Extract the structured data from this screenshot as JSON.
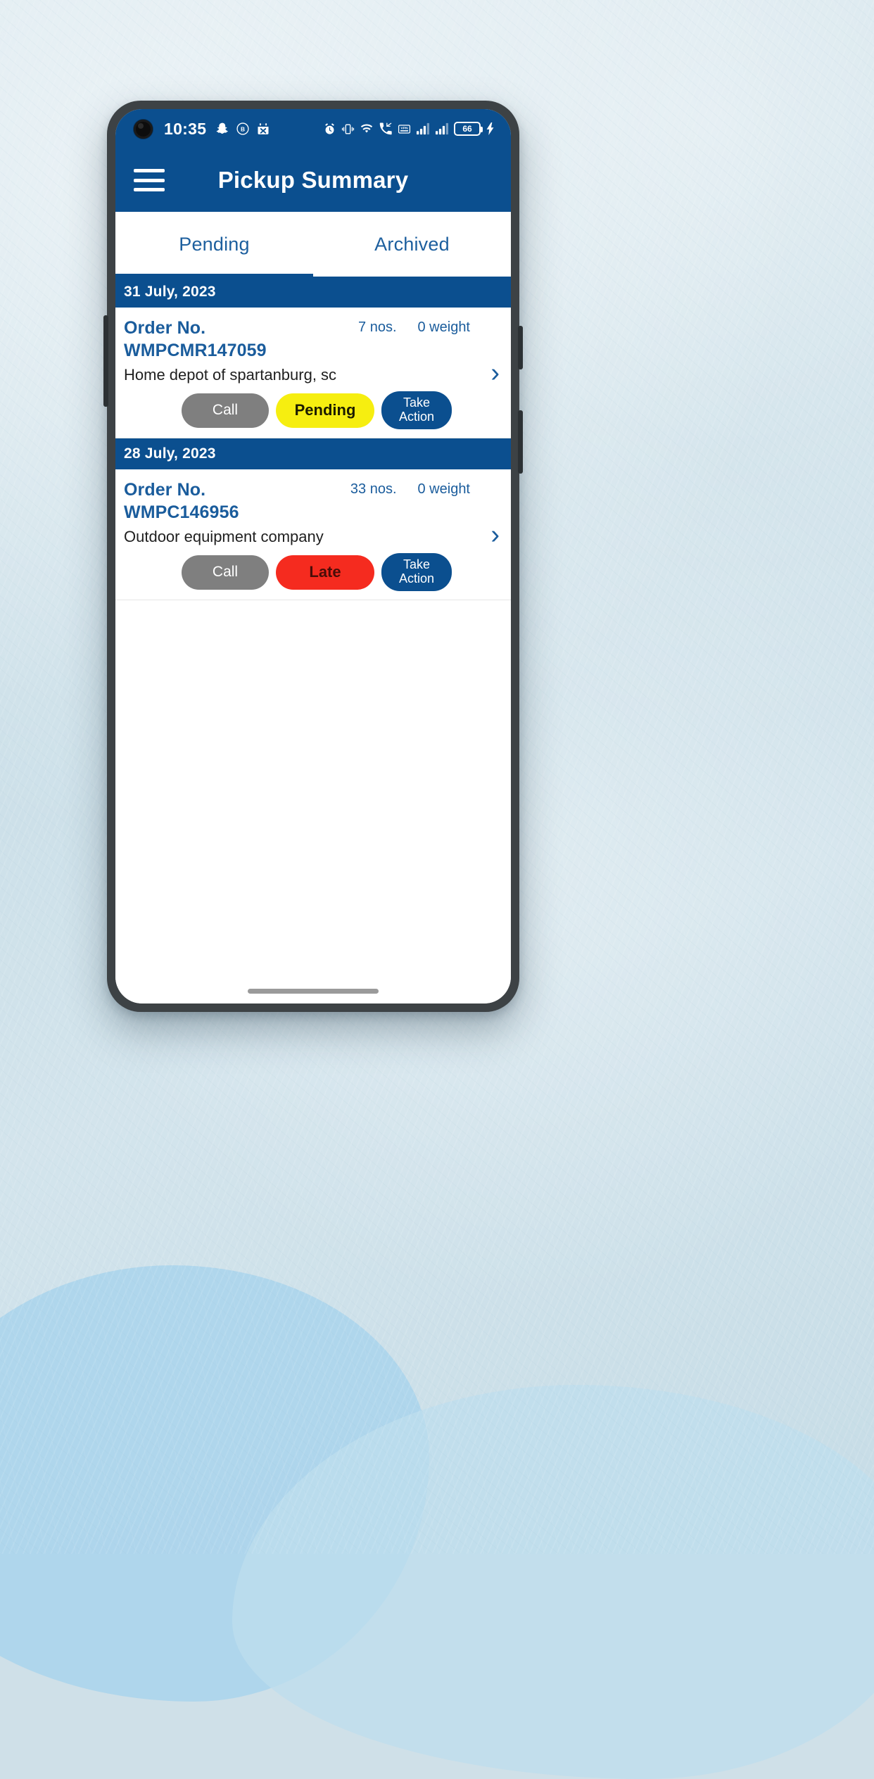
{
  "status_bar": {
    "time": "10:35",
    "battery_level": "66",
    "left_icons": [
      "snapchat-icon",
      "circled-b-icon",
      "calendar-event-icon"
    ],
    "right_icons": [
      "alarm-icon",
      "vibrate-icon",
      "wifi-icon",
      "missed-call-icon",
      "vpn-key-icon",
      "signal-bars-icon",
      "signal-bars-2-icon",
      "battery-icon",
      "charging-bolt-icon"
    ]
  },
  "app_bar": {
    "title": "Pickup Summary",
    "menu_icon": "hamburger-menu-icon"
  },
  "tabs": [
    {
      "label": "Pending",
      "active": true
    },
    {
      "label": "Archived",
      "active": false
    }
  ],
  "colors": {
    "primary": "#0b4f8f",
    "link": "#1a5c9c",
    "call_grey": "#7f7f7f",
    "pending_yellow": "#f6ee10",
    "late_red": "#f52b1f"
  },
  "groups": [
    {
      "date": "31 July, 2023",
      "orders": [
        {
          "order_label": "Order No.",
          "order_number": "WMPCMR147059",
          "count": "7 nos.",
          "weight": "0 weight",
          "company": "Home depot of spartanburg, sc",
          "call_label": "Call",
          "status_label": "Pending",
          "status_color": "#f6ee10",
          "status_text_color": "#1c1c00",
          "action_line1": "Take",
          "action_line2": "Action",
          "chevron": "chevron-right-icon"
        }
      ]
    },
    {
      "date": "28 July, 2023",
      "orders": [
        {
          "order_label": "Order No.",
          "order_number": "WMPC146956",
          "count": "33 nos.",
          "weight": "0 weight",
          "company": "Outdoor equipment company",
          "call_label": "Call",
          "status_label": "Late",
          "status_color": "#f52b1f",
          "status_text_color": "#4a0d08",
          "action_line1": "Take",
          "action_line2": "Action",
          "chevron": "chevron-right-icon"
        }
      ]
    }
  ]
}
